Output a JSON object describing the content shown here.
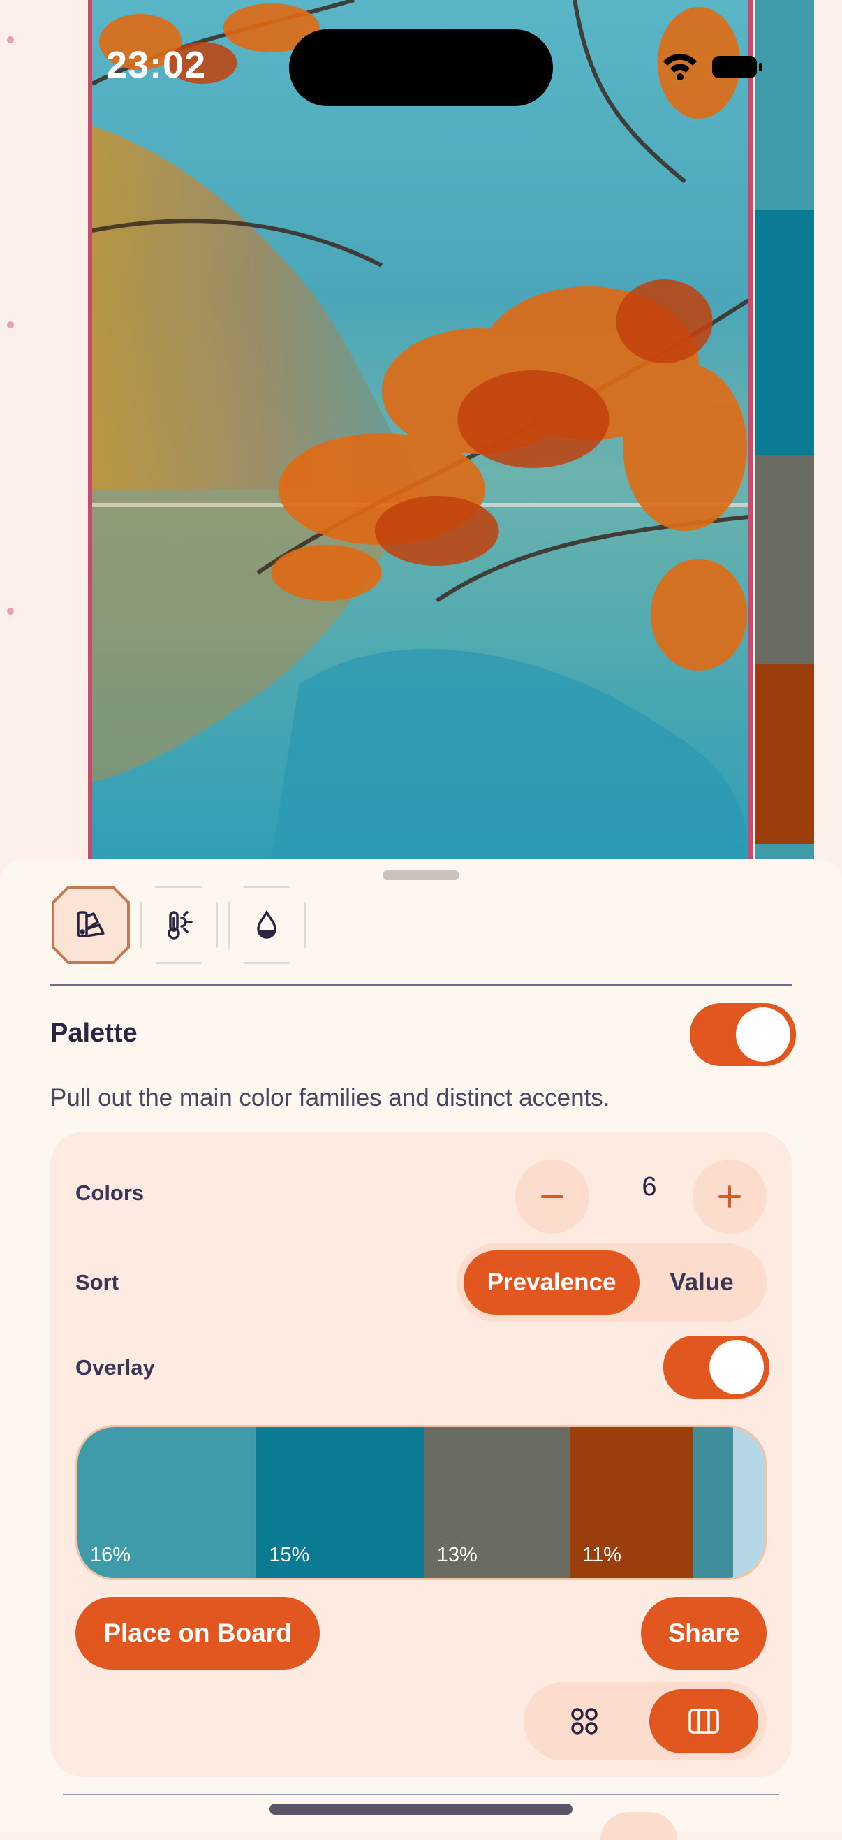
{
  "status_bar": {
    "time": "23:02"
  },
  "photo": {
    "subject": "autumn-branches-over-lake"
  },
  "side_strip_colors": [
    "#3f9ba9",
    "#0b7a93",
    "#6a6b61",
    "#9a3f0c",
    "#3f9ba9"
  ],
  "toolbar": {
    "tools": [
      {
        "icon": "palette-icon",
        "active": true
      },
      {
        "icon": "temperature-icon",
        "active": false
      },
      {
        "icon": "drop-icon",
        "active": false
      }
    ]
  },
  "palette_section": {
    "title": "Palette",
    "enabled": true,
    "description": "Pull out the main color families and distinct accents."
  },
  "colors_row": {
    "label": "Colors",
    "value": "6"
  },
  "sort_row": {
    "label": "Sort",
    "options": [
      "Prevalence",
      "Value"
    ],
    "selected": "Prevalence"
  },
  "overlay_row": {
    "label": "Overlay",
    "enabled": true
  },
  "palette": [
    {
      "color": "#3f9ba9",
      "share": 0.16,
      "label": "16%"
    },
    {
      "color": "#0b7a93",
      "share": 0.15,
      "label": "15%"
    },
    {
      "color": "#6a6b61",
      "share": 0.13,
      "label": "13%"
    },
    {
      "color": "#9a3f0c",
      "share": 0.11,
      "label": "11%"
    },
    {
      "color": "#3f8f9d",
      "share": 0.036,
      "label": ""
    },
    {
      "color": "#b6d8e6",
      "share": 0.028,
      "label": ""
    }
  ],
  "actions": {
    "place_on_board": "Place on Board",
    "share": "Share"
  },
  "view_mode": {
    "options": [
      "grid-icon",
      "columns-icon"
    ],
    "selected": "columns-icon"
  },
  "colors": {
    "accent": "#e2571f",
    "frame": "#c64b6c",
    "sheet": "#fdf7f0",
    "card": "#fdebe1"
  }
}
